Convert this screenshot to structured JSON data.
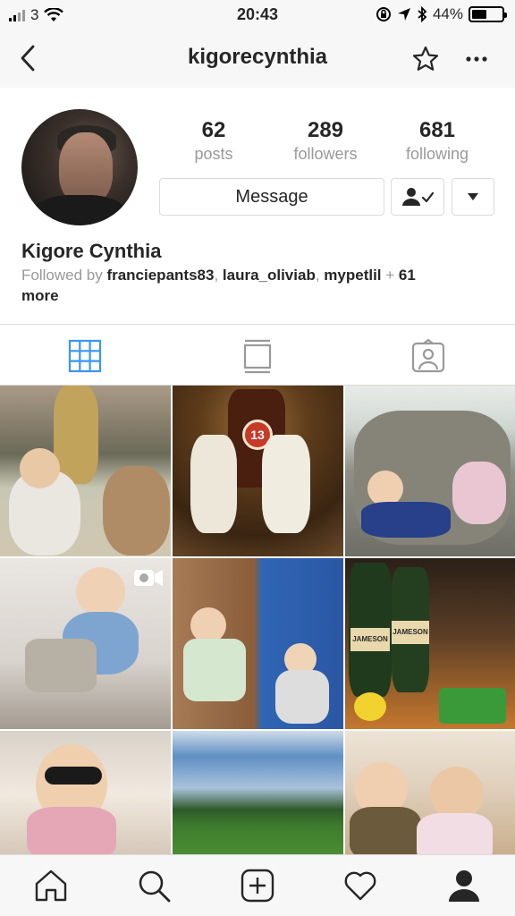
{
  "status_bar": {
    "carrier": "3",
    "time": "20:43",
    "battery_percent": "44%",
    "battery_level": 0.44
  },
  "header": {
    "username": "kigorecynthia",
    "back_icon": "chevron-left-icon",
    "star_icon": "star-icon",
    "more_icon": "more-horizontal-icon"
  },
  "profile": {
    "stats": [
      {
        "value": "62",
        "label": "posts"
      },
      {
        "value": "289",
        "label": "followers"
      },
      {
        "value": "681",
        "label": "following"
      }
    ],
    "message_button": "Message",
    "display_name": "Kigore Cynthia",
    "followed_by": {
      "prefix": "Followed by ",
      "users": [
        "franciepants83",
        "laura_oliviab",
        "mypetlil"
      ],
      "sep": ", ",
      "plus": " + ",
      "more_count": "61",
      "more_word": "more"
    }
  },
  "tabs": [
    {
      "name": "grid",
      "icon": "grid-icon",
      "active": true
    },
    {
      "name": "feed",
      "icon": "list-icon",
      "active": false
    },
    {
      "name": "tagged",
      "icon": "tagged-person-icon",
      "active": false
    }
  ],
  "posts": {
    "label_texts": [
      "JAMESON",
      "JAMESON",
      "13"
    ]
  },
  "colors": {
    "accent_blue": "#3897f0",
    "text_dark": "#262626",
    "text_gray": "#999999",
    "border": "#dbdbdb"
  }
}
